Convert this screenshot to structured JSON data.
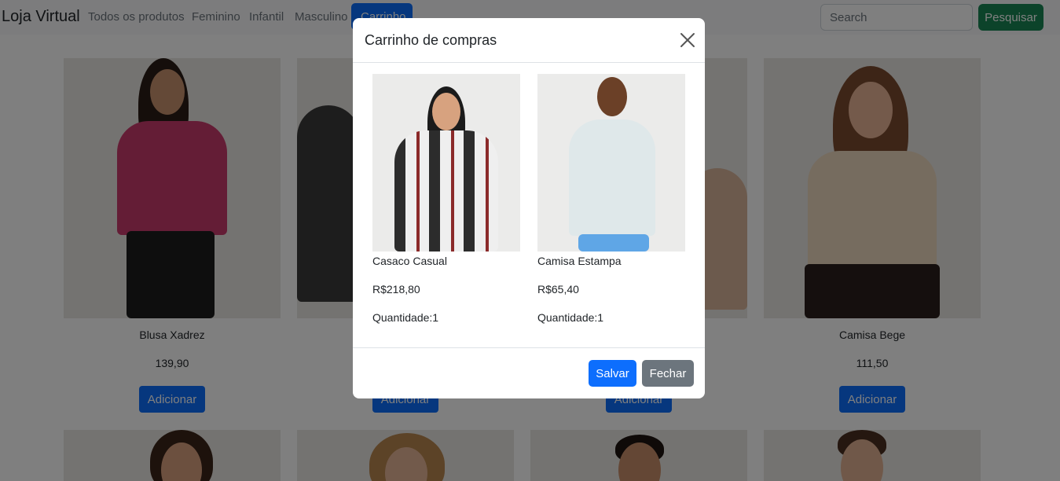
{
  "navbar": {
    "brand": "Loja Virtual",
    "links": [
      "Todos os produtos",
      "Feminino",
      "Infantil",
      "Masculino"
    ],
    "active_link": "Carrinho",
    "search_placeholder": "Search",
    "search_button": "Pesquisar"
  },
  "products": [
    {
      "name": "Blusa Xadrez",
      "price": "139,90",
      "button": "Adicionar"
    },
    {
      "name": "",
      "price": "",
      "button": "Adicionar"
    },
    {
      "name": "",
      "price": "",
      "button": "Adicionar"
    },
    {
      "name": "Camisa Bege",
      "price": "111,50",
      "button": "Adicionar"
    }
  ],
  "modal": {
    "title": "Carrinho de compras",
    "items": [
      {
        "name": "Casaco Casual",
        "price": "R$218,80",
        "quantity": "Quantidade:1"
      },
      {
        "name": "Camisa Estampa",
        "price": "R$65,40",
        "quantity": "Quantidade:1"
      }
    ],
    "save_label": "Salvar",
    "close_label": "Fechar"
  },
  "colors": {
    "primary": "#0d6efd",
    "success": "#198754",
    "secondary": "#6c757d"
  }
}
